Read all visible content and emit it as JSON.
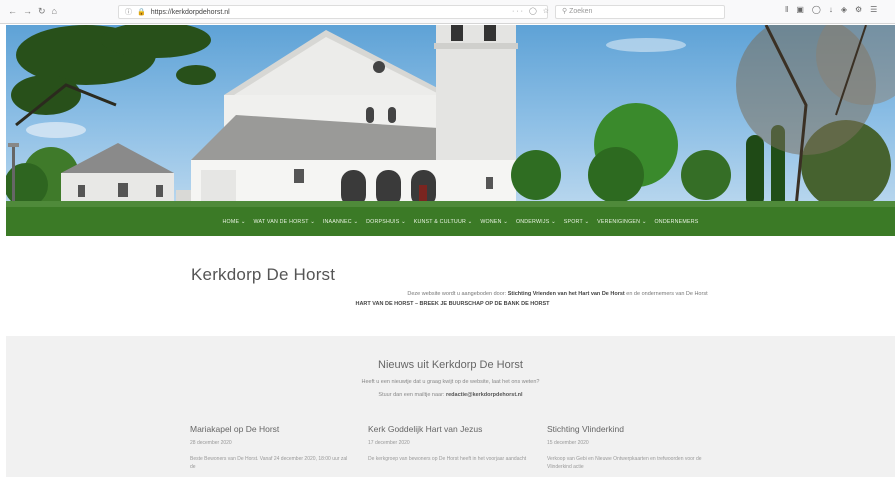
{
  "browser": {
    "url": "https://kerkdorpdehorst.nl",
    "search_placeholder": "Zoeken",
    "nav_icons": [
      "back-icon",
      "forward-icon",
      "reload-icon",
      "home-icon"
    ],
    "toolbar_icons": [
      "library-icon",
      "sidebar-icon",
      "pocket-icon",
      "download-icon",
      "extension-icon",
      "addon-icon",
      "menu-icon"
    ]
  },
  "nav": {
    "items": [
      "HOME",
      "WAT VAN DE HORST",
      "INAANNEC",
      "DORPSHUIS",
      "KUNST & CULTUUR",
      "WONEN",
      "ONDERWIJS",
      "SPORT",
      "VERENIGINGEN",
      "ONDERNEMERS"
    ]
  },
  "intro": {
    "title": "Kerkdorp De Horst",
    "line1_prefix": "Deze website wordt u aangeboden door:",
    "line1_org": "Stichting Vrienden van het Hart van De Horst",
    "line1_suffix": "en de ondernemers van De Horst",
    "line2": "HART VAN DE HORST – BREEK JE BUURSCHAP OP DE BANK DE HORST"
  },
  "news": {
    "title": "Nieuws uit Kerkdorp De Horst",
    "sub1": "Heeft u een nieuwtje dat u graag kwijt op de website, laat het ons weten?",
    "sub2_prefix": "Stuur dan een mailtje naar:",
    "sub2_email": "redactie@kerkdorpdehorst.nl",
    "articles": [
      {
        "title": "Mariakapel op De Horst",
        "date": "28 december 2020",
        "text": "Beste Bewoners van De Horst. Vanaf 24 december 2020, 18:00 uur zal de"
      },
      {
        "title": "Kerk Goddelijk Hart van Jezus",
        "date": "17 december 2020",
        "text": "De kerkgroep van bewoners op De Horst heeft in het voorjaar aandacht"
      },
      {
        "title": "Stichting Vlinderkind",
        "date": "15 december 2020",
        "text": "Verkoop van Gebi en Nieuwe Ontwerpkaarten en trefwoorden voor de Vlinderkind actie"
      }
    ]
  },
  "colors": {
    "nav_green": "#3b7a26",
    "news_bg": "#f1f1f1",
    "sky": "#5ea2d6"
  }
}
